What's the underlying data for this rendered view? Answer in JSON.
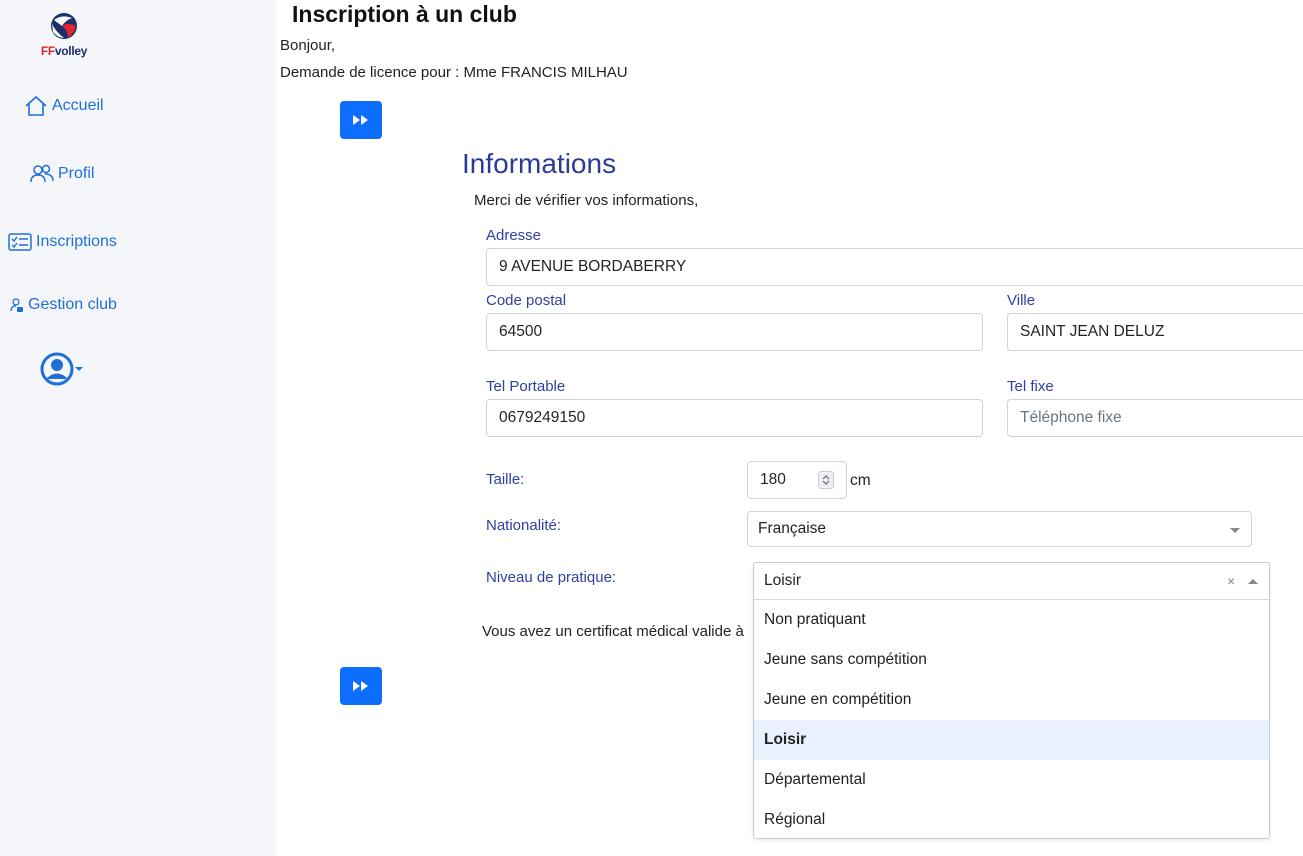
{
  "sidebar": {
    "logo_text_ff": "FF",
    "logo_text_volley": "volley",
    "items": [
      {
        "label": "Accueil",
        "icon": "home-icon"
      },
      {
        "label": "Profil",
        "icon": "users-icon"
      },
      {
        "label": "Inscriptions",
        "icon": "checklist-icon"
      },
      {
        "label": "Gestion club",
        "icon": "user-lock-icon"
      }
    ],
    "user_menu_icon": "user-circle-icon"
  },
  "header": {
    "title": "Inscription à un club",
    "greeting": "Bonjour,",
    "request": "Demande de licence pour : Mme FRANCIS MILHAU"
  },
  "form": {
    "section_title": "Informations",
    "intro": "Merci de vérifier vos informations,",
    "adresse": {
      "label": "Adresse",
      "value": "9 AVENUE BORDABERRY"
    },
    "code_postal": {
      "label": "Code postal",
      "value": "64500"
    },
    "ville": {
      "label": "Ville",
      "value": "SAINT JEAN DELUZ"
    },
    "tel_portable": {
      "label": "Tel Portable",
      "value": "0679249150"
    },
    "tel_fixe": {
      "label": "Tel fixe",
      "value": "",
      "placeholder": "Téléphone fixe"
    },
    "taille": {
      "label": "Taille:",
      "value": "180",
      "unit": "cm"
    },
    "nationalite": {
      "label": "Nationalité:",
      "value": "Française"
    },
    "niveau": {
      "label": "Niveau de pratique:",
      "value": "Loisir",
      "clear": "×",
      "options": [
        "Non pratiquant",
        "Jeune sans compétition",
        "Jeune en compétition",
        "Loisir",
        "Départemental",
        "Régional"
      ],
      "selected_index": 3
    },
    "certificat_text": "Vous avez un certificat médical valide à"
  },
  "colors": {
    "accent": "#0d6efd",
    "link": "#1f6fd6",
    "label": "#2f3fa3",
    "sidebar_bg": "#f4f6f9",
    "selected_option_bg": "#e8f1fd"
  }
}
